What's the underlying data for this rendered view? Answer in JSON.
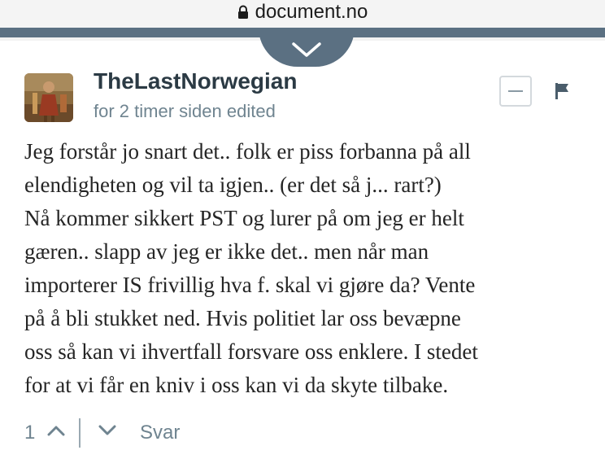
{
  "browser": {
    "url": "document.no"
  },
  "comment": {
    "username": "TheLastNorwegian",
    "time": "for 2 timer siden",
    "edited": "edited",
    "text_lines": [
      "Jeg forstår jo snart det.. folk er piss forbanna på all",
      "elendigheten og vil ta igjen.. (er det så j... rart?)",
      "Nå kommer sikkert PST og lurer på om jeg er helt",
      "gæren.. slapp av jeg er ikke det.. men når man",
      "importerer IS frivillig hva f. skal vi gjøre da? Vente",
      "på å bli stukket ned. Hvis politiet lar oss bevæpne",
      "oss så kan vi ihvertfall forsvare oss enklere. I stedet",
      "for at vi får en kniv i oss kan vi da skyte tilbake."
    ],
    "votes": "1",
    "reply_label": "Svar"
  },
  "colors": {
    "header_bar": "#5b7082",
    "username": "#2b3a44",
    "meta": "#6f8490"
  }
}
